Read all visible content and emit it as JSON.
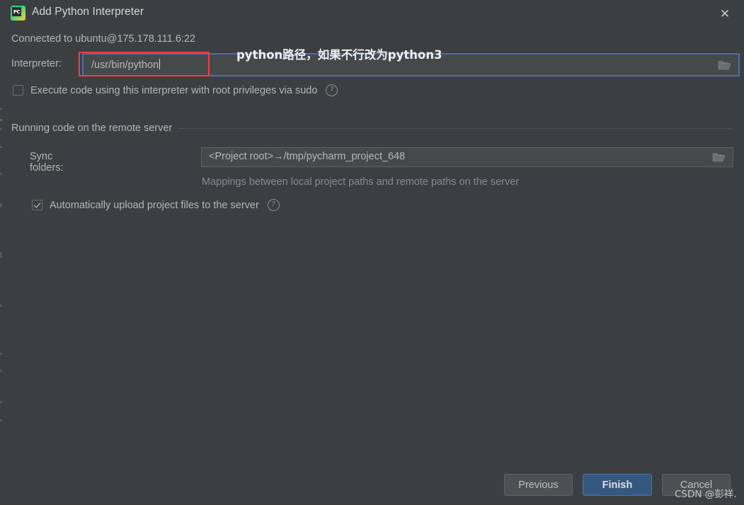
{
  "window": {
    "title": "Add Python Interpreter",
    "app_icon": "pycharm-icon",
    "app_icon_badge": "PC",
    "close_icon": "✕"
  },
  "status": {
    "connected_text": "Connected to ubuntu@175.178.111.6:22"
  },
  "interpreter": {
    "label": "Interpreter:",
    "value": "/usr/bin/python",
    "browse_icon": "folder-icon",
    "annotation": "python路径，如果不行改为python3",
    "highlight_color": "#fb3b3b",
    "focus_color": "#4b6eaf"
  },
  "sudo": {
    "label": "Execute code using this interpreter with root privileges via sudo",
    "checked": false,
    "help_icon": "?"
  },
  "remote_section": {
    "title": "Running code on the remote server",
    "sync": {
      "label": "Sync folders:",
      "value": "<Project root>→/tmp/pycharm_project_648",
      "browse_icon": "folder-icon"
    },
    "hint": "Mappings between local project paths and remote paths on the server",
    "auto_upload": {
      "label": "Automatically upload project files to the server",
      "checked": true,
      "help_icon": "?"
    }
  },
  "buttons": {
    "previous": "Previous",
    "finish": "Finish",
    "cancel": "Cancel",
    "finish_color": "#365880"
  },
  "watermark": {
    "text": "CSDN @彭祥."
  }
}
